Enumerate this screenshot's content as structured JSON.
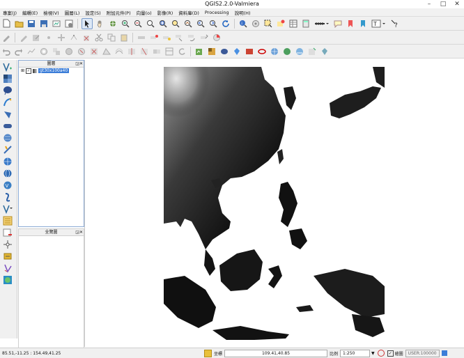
{
  "window": {
    "title": "QGIS2.2.0-Valmiera"
  },
  "menu": [
    "專案(J)",
    "編輯(E)",
    "檢視(V)",
    "圖層(L)",
    "設定(S)",
    "附加元件(P)",
    "向量(o)",
    "影像(R)",
    "資料庫(D)",
    "Processing",
    "說明(H)"
  ],
  "layers_panel": {
    "title": "圖層",
    "layer_name": "gt30x100a40"
  },
  "overview_panel": {
    "title": "全覽圖"
  },
  "status": {
    "coords": "85.51,-11.25 : 154.49,41.25",
    "coord_label": "坐標",
    "coord_value": "109.41,40.85",
    "scale_label": "比例",
    "scale_value": "1:250",
    "render_label": "繪圖",
    "epsg": "USER:100000"
  },
  "colors": {
    "accent": "#3b7dd8",
    "panel_border": "#8aa9d4"
  }
}
